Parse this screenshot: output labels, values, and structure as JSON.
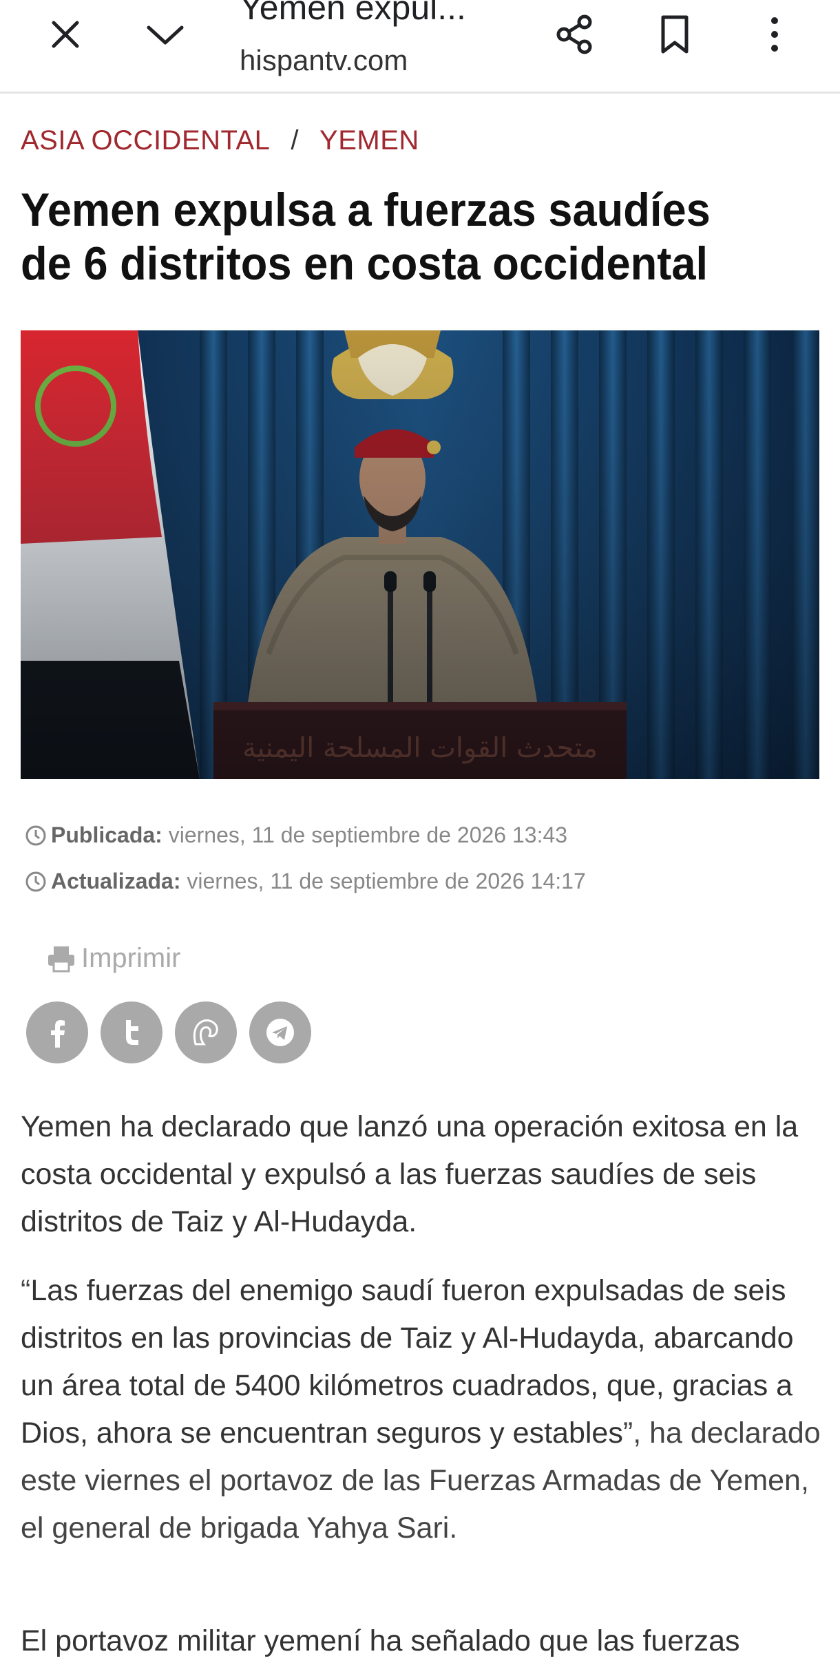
{
  "browser": {
    "tab_title": "Yemen expul...",
    "domain": "hispantv.com"
  },
  "breadcrumb": {
    "section": "ASIA OCCIDENTAL",
    "separator": "/",
    "subsection": "YEMEN"
  },
  "article": {
    "headline": "Yemen expulsa a fuerzas saudíes de 6 distritos en costa occidental",
    "published_label": "Publicada:",
    "published_value": "viernes, 11 de septiembre de 2026 13:43",
    "updated_label": "Actualizada:",
    "updated_value": "viernes, 11 de septiembre de 2026 14:17",
    "print_label": "Imprimir",
    "lead": "Yemen ha declarado que lanzó una operación exitosa en la costa occidental y expulsó a las fuerzas saudíes de seis distritos de Taiz y Al-Hudayda.",
    "quote_open": "“",
    "quote": "Las fuerzas del enemigo saudí fueron expulsadas de seis distritos en las provincias de Taiz y Al-Hudayda, abarcando un área total de 5400 kilómetros cuadrados, que, gracias a Dios, ahora se encuentran seguros y estables",
    "quote_close": "”",
    "quote_tail": ", ha declarado este viernes el portavoz de las Fuerzas Armadas de Yemen, el general de brigada Yahya Sari.",
    "para3": "El portavoz militar yemení ha señalado que las fuerzas",
    "image_caption_text": "متحدث القوات المسلحة اليمنية"
  },
  "social": [
    "facebook-icon",
    "twitter-icon",
    "vk-icon",
    "telegram-icon"
  ],
  "colors": {
    "breadcrumb": "#a0282e",
    "social_bg": "#a9a9a9",
    "curtain": "#0d2a48"
  }
}
